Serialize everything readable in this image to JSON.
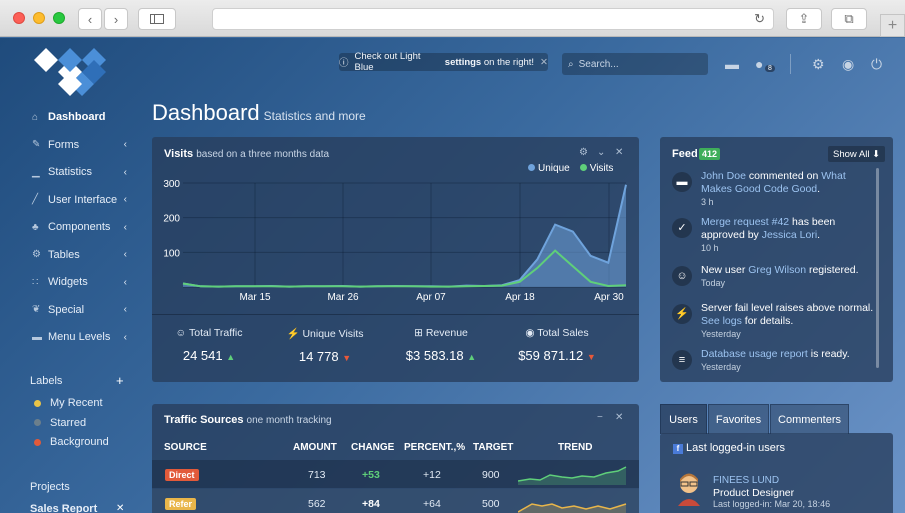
{
  "browser": {
    "search_placeholder": ""
  },
  "sidebar": {
    "items": [
      {
        "label": "Dashboard",
        "icon": "home-icon",
        "active": true
      },
      {
        "label": "Forms",
        "icon": "pencil-icon"
      },
      {
        "label": "Statistics",
        "icon": "chart-icon"
      },
      {
        "label": "User Interface",
        "icon": "magic-icon"
      },
      {
        "label": "Components",
        "icon": "tree-icon"
      },
      {
        "label": "Tables",
        "icon": "gear-icon"
      },
      {
        "label": "Widgets",
        "icon": "grid-icon"
      },
      {
        "label": "Special",
        "icon": "leaf-icon"
      },
      {
        "label": "Menu Levels",
        "icon": "folder-icon"
      }
    ],
    "labels_title": "Labels",
    "labels": [
      {
        "label": "My Recent",
        "color": "#e9c448"
      },
      {
        "label": "Starred",
        "color": "#6c7f8c"
      },
      {
        "label": "Background",
        "color": "#e25a3a"
      }
    ],
    "projects_title": "Projects",
    "projects": [
      {
        "label": "Sales Report"
      }
    ]
  },
  "topbar": {
    "notice_prefix": "Check out Light Blue ",
    "notice_bold": "settings",
    "notice_suffix": " on the right!",
    "search_placeholder": "Search...",
    "notification_count": "8"
  },
  "page": {
    "title": "Dashboard",
    "subtitle": "Statistics and more"
  },
  "visits": {
    "title": "Visits",
    "subtitle": "based on a three months data",
    "legend": [
      {
        "name": "Unique",
        "color": "#6fa3dc"
      },
      {
        "name": "Visits",
        "color": "#5fcf7a"
      }
    ],
    "stats": [
      {
        "label": "Total Traffic",
        "value": "24 541",
        "trend": "up"
      },
      {
        "label": "Unique Visits",
        "value": "14 778",
        "trend": "down"
      },
      {
        "label": "Revenue",
        "value": "$3 583.18",
        "trend": "up"
      },
      {
        "label": "Total Sales",
        "value": "$59 871.12",
        "trend": "down"
      }
    ]
  },
  "chart_data": {
    "type": "area",
    "x": [
      "Mar 15",
      "Mar 26",
      "Apr 07",
      "Apr 18",
      "Apr 30"
    ],
    "ylim": [
      0,
      300
    ],
    "yticks": [
      100,
      200,
      300
    ],
    "series": [
      {
        "name": "Unique",
        "values": [
          10,
          2,
          1,
          2,
          2,
          3,
          1,
          2,
          2,
          3,
          1,
          2,
          3,
          2,
          2,
          1,
          4,
          3,
          5,
          20,
          80,
          180,
          160,
          90,
          70,
          295
        ]
      },
      {
        "name": "Visits",
        "values": [
          10,
          2,
          1,
          2,
          2,
          2,
          1,
          2,
          2,
          2,
          1,
          2,
          2,
          2,
          1,
          1,
          2,
          3,
          4,
          15,
          55,
          105,
          60,
          15,
          3,
          5
        ]
      }
    ]
  },
  "feed": {
    "title": "Feed",
    "count": "412",
    "show_all": "Show All",
    "items": [
      {
        "icon": "comment-icon",
        "pre": "",
        "link1": "John Doe",
        "mid": " commented on ",
        "link2": "What Makes Good Code Good",
        "post": ".",
        "time": "3 h"
      },
      {
        "icon": "check-icon",
        "pre": "",
        "link1": "Merge request #42",
        "mid": " has been approved by ",
        "link2": "Jessica Lori",
        "post": ".",
        "time": "10 h"
      },
      {
        "icon": "user-icon",
        "pre": "New user ",
        "link1": "Greg Wilson",
        "mid": " registered.",
        "link2": "",
        "post": "",
        "time": "Today"
      },
      {
        "icon": "bolt-icon",
        "pre": "Server fail level raises above normal. ",
        "link1": "See logs",
        "mid": " for details.",
        "link2": "",
        "post": "",
        "time": "Yesterday"
      },
      {
        "icon": "database-icon",
        "pre": "",
        "link1": "Database usage report",
        "mid": " is ready.",
        "link2": "",
        "post": "",
        "time": "Yesterday"
      }
    ]
  },
  "traffic": {
    "title": "Traffic Sources",
    "subtitle": "one month tracking",
    "columns": [
      "SOURCE",
      "AMOUNT",
      "CHANGE",
      "PERCENT.,%",
      "TARGET",
      "TREND"
    ],
    "rows": [
      {
        "source": "Direct",
        "tag_color": "#e25a3a",
        "amount": "713",
        "change": "+53",
        "percent": "+12",
        "target": "900",
        "trend_color": "#5fcf7a"
      },
      {
        "source": "Refer",
        "tag_color": "#e9b64a",
        "amount": "562",
        "change": "+84",
        "percent": "+64",
        "target": "500",
        "trend_color": "#e9b64a"
      }
    ]
  },
  "users": {
    "tabs": [
      "Users",
      "Favorites",
      "Commenters"
    ],
    "header": "Last logged-in users",
    "list": [
      {
        "name": "FINEES LUND",
        "role": "Product Designer",
        "last": "Last logged-in: Mar 20, 18:46"
      }
    ]
  }
}
